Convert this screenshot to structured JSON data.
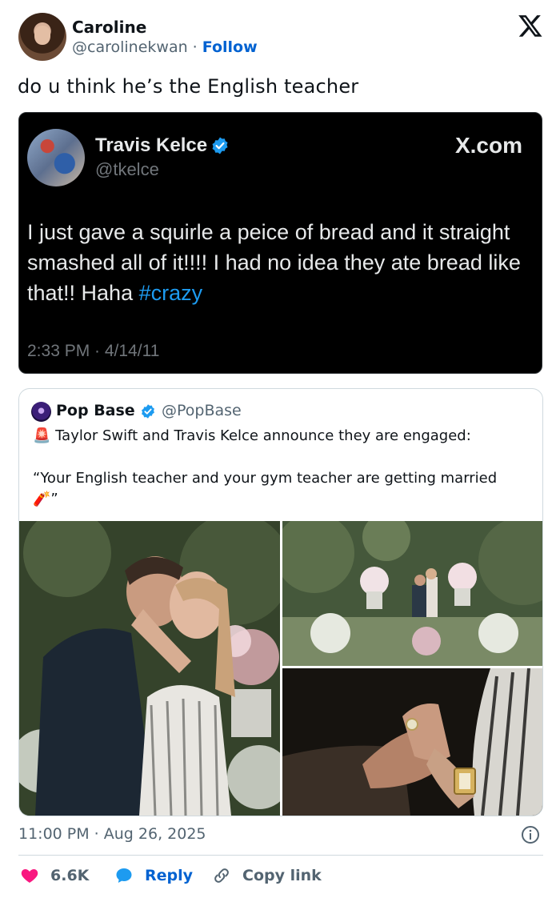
{
  "author": {
    "name": "Caroline",
    "handle": "@carolinekwan",
    "separator": "·",
    "follow_label": "Follow"
  },
  "tweet_text": "do u think he’s the English teacher",
  "embedded_screenshot": {
    "name": "Travis Kelce",
    "handle": "@tkelce",
    "brand": "X.com",
    "body_text": "I just gave a squirle a peice of bread and it straight smashed all of it!!!! I had no idea they ate bread like that!! Haha ",
    "hashtag": "#crazy",
    "timestamp": "2:33 PM · 4/14/11"
  },
  "quoted_tweet": {
    "name": "Pop Base",
    "handle": "@PopBase",
    "line1_emoji": "🚨",
    "line1": "Taylor Swift and Travis Kelce announce they are engaged:",
    "line2": "“Your English teacher and your gym teacher are getting married",
    "line2_emoji": "🧨",
    "line2_end": "”",
    "photos": [
      "couple-embrace-photo",
      "garden-proposal-photo",
      "ring-hands-photo"
    ]
  },
  "timestamp": "11:00 PM · Aug 26, 2025",
  "actions": {
    "like_count": "6.6K",
    "reply_label": "Reply",
    "copy_label": "Copy link"
  },
  "colors": {
    "follow_blue": "#0062d1",
    "like_red": "#f91880",
    "verified_blue": "#1d9bf0",
    "hashtag_blue": "#1d9bf0",
    "dark_bg": "#000000"
  },
  "icons": [
    "x-logo-icon",
    "verified-badge-icon",
    "info-icon",
    "heart-icon",
    "reply-bubble-icon",
    "link-icon"
  ]
}
